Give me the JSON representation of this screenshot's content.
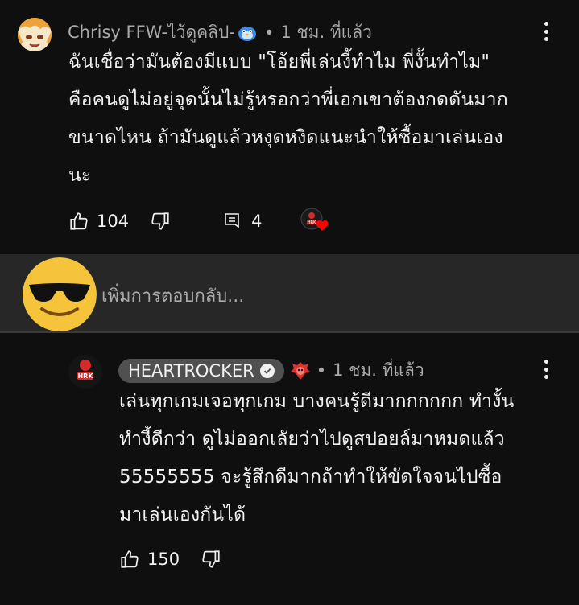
{
  "top_comment": {
    "author": "Chrisy FFW-ไว้ดูคลิป-",
    "time": "1 ชม. ที่แล้ว",
    "lines": [
      "ฉันเชื่อว่ามันต้องมีแบบ \"โอ้ยพี่เล่นงี้ทำไม พี่งั้นทำไม\"",
      "คือคนดูไม่อยู่จุดนั้นไม่รู้หรอกว่าพี่เอกเขาต้องกดดันมาก",
      "ขนาดไหน ถ้ามันดูแล้วหงุดหงิดแนะนำให้ซื้อมาเล่นเอง",
      "นะ"
    ],
    "like_count": "104",
    "reply_count": "4"
  },
  "reply_box": {
    "placeholder": "เพิ่มการตอบกลับ..."
  },
  "reply_comment": {
    "author": "HEARTROCKER",
    "time": "1 ชม. ที่แล้ว",
    "lines": [
      "เล่นทุกเกมเจอทุกเกม บางคนรู้ดีมากกกกกก ทำงั้น",
      "ทำงี้ดีกว่า ดูไม่ออกเลัยว่าไปดูสปอยล์มาหมดแล้ว",
      "55555555 จะรู้สึกดีมากถ้าทำให้ขัดใจจนไปซื้อ",
      "มาเล่นเองกันได้"
    ],
    "like_count": "150"
  },
  "colors": {
    "background": "#0f0f0f",
    "reply_bar": "#272727",
    "text": "#f1f1f1",
    "meta": "#aaaaaa",
    "heart": "#ff0000"
  }
}
